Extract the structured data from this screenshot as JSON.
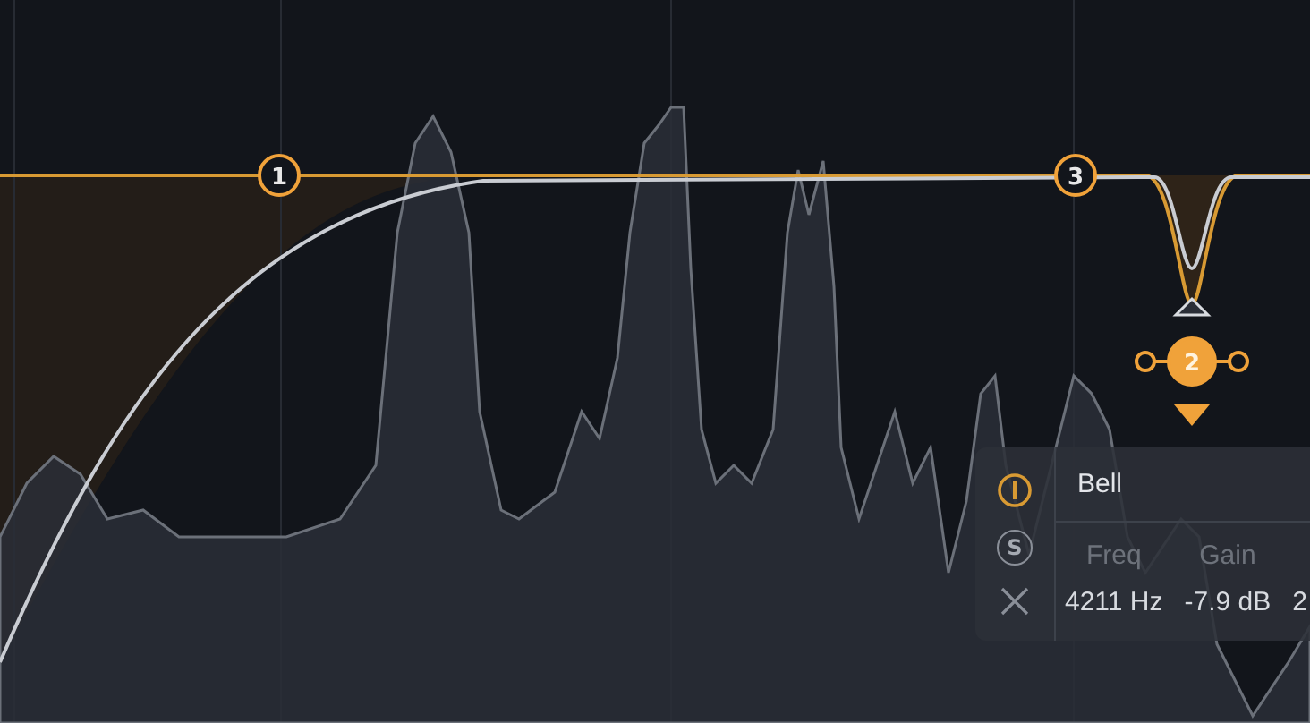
{
  "bands": [
    {
      "label": "1",
      "selected": false
    },
    {
      "label": "3",
      "selected": false
    },
    {
      "label": "2",
      "selected": true
    }
  ],
  "band_panel": {
    "enabled": true,
    "solo_label": "S",
    "solo": false,
    "shape": "Bell",
    "params": [
      {
        "label": "Freq",
        "value": "4211 Hz"
      },
      {
        "label": "Gain",
        "value": "-7.9 dB"
      },
      {
        "value": "2"
      }
    ]
  }
}
